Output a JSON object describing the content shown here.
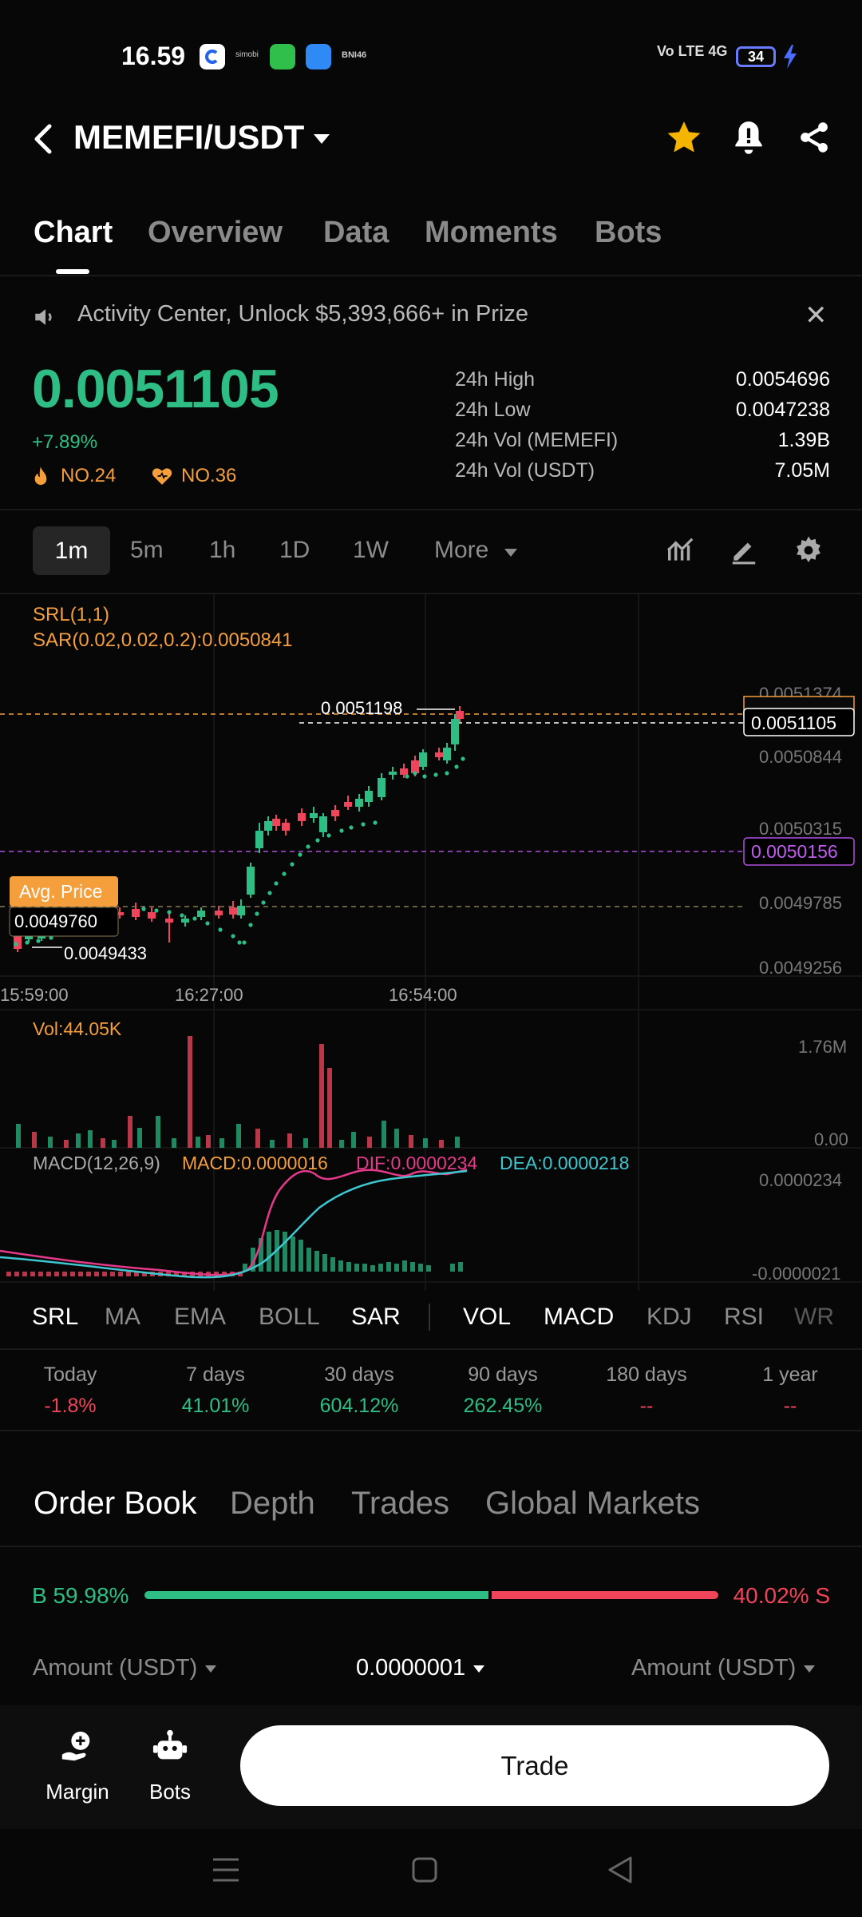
{
  "status_bar": {
    "time": "16.59",
    "app_label_1": "simobi",
    "app_label_2": "BNI46",
    "network": "Vo LTE 4G",
    "battery": "34"
  },
  "header": {
    "pair": "MEMEFI/USDT"
  },
  "tabs": [
    {
      "label": "Chart",
      "active": true
    },
    {
      "label": "Overview"
    },
    {
      "label": "Data"
    },
    {
      "label": "Moments"
    },
    {
      "label": "Bots"
    }
  ],
  "banner": {
    "text": "Activity Center, Unlock $5,393,666+ in Prize"
  },
  "price": {
    "last": "0.0051105",
    "change": "+7.89%",
    "rank_hot": "NO.24",
    "rank_fav": "NO.36"
  },
  "stats": [
    {
      "label": "24h High",
      "value": "0.0054696"
    },
    {
      "label": "24h Low",
      "value": "0.0047238"
    },
    {
      "label": "24h Vol (MEMEFI)",
      "value": "1.39B"
    },
    {
      "label": "24h Vol (USDT)",
      "value": "7.05M"
    }
  ],
  "timeframes": [
    "1m",
    "5m",
    "1h",
    "1D",
    "1W",
    "More"
  ],
  "chart": {
    "indicator_1": "SRL(1,1)",
    "indicator_2": "SAR(0.02,0.02,0.2):0.0050841",
    "high_marker": "0.0051198",
    "low_marker": "0.0049433",
    "avg_label": "Avg. Price",
    "avg_value": "0.0049760",
    "current_tag": "0.0051105",
    "purple_tag": "0.0050156",
    "y_ticks": [
      "0.0051374",
      "0.0050844",
      "0.0050315",
      "0.0049785",
      "0.0049256"
    ],
    "x_ticks": [
      "15:59:00",
      "16:27:00",
      "16:54:00"
    ],
    "vol_label": "Vol:44.05K",
    "vol_ticks": [
      "1.76M",
      "0.00"
    ],
    "macd_label": "MACD(12,26,9)",
    "macd_val": "MACD:0.0000016",
    "dif_val": "DIF:0.0000234",
    "dea_val": "DEA:0.0000218",
    "macd_ticks": [
      "0.0000234",
      "-0.0000021"
    ],
    "colors": {
      "up": "#2ebd85",
      "down": "#f0445a",
      "sar": "#2ebd85",
      "dif": "#e6398a",
      "dea": "#3ec7d0",
      "orange": "#f59e3c",
      "purple": "#b34fe0"
    }
  },
  "indicators_main": [
    "SRL",
    "MA",
    "EMA",
    "BOLL",
    "SAR"
  ],
  "indicators_sub": [
    "VOL",
    "MACD",
    "KDJ",
    "RSI",
    "WR"
  ],
  "performance": [
    {
      "label": "Today",
      "value": "-1.8%",
      "color": "red"
    },
    {
      "label": "7 days",
      "value": "41.01%",
      "color": "green"
    },
    {
      "label": "30 days",
      "value": "604.12%",
      "color": "green"
    },
    {
      "label": "90 days",
      "value": "262.45%",
      "color": "green"
    },
    {
      "label": "180 days",
      "value": "--",
      "color": "red"
    },
    {
      "label": "1 year",
      "value": "--",
      "color": "red"
    }
  ],
  "order_book": {
    "tabs": [
      "Order Book",
      "Depth",
      "Trades",
      "Global Markets"
    ],
    "buy_pct": "B 59.98%",
    "sell_pct": "40.02% S",
    "buy_fraction": 0.5998,
    "col_left": "Amount (USDT)",
    "col_mid": "0.0000001",
    "col_right": "Amount (USDT)"
  },
  "bottom_bar": {
    "margin": "Margin",
    "bots": "Bots",
    "trade": "Trade"
  }
}
